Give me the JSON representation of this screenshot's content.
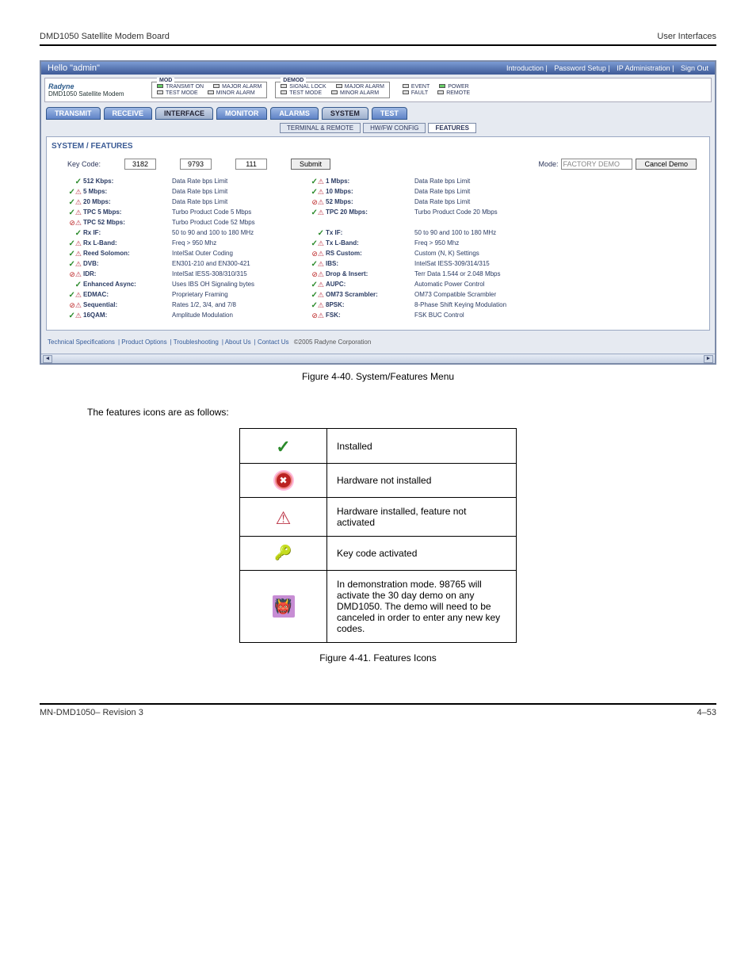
{
  "doc": {
    "header_left": "DMD1050 Satellite Modem Board",
    "header_right": "User Interfaces",
    "footer_left": "MN-DMD1050– Revision 3",
    "footer_right": "4–53"
  },
  "app": {
    "hello": "Hello \"admin\"",
    "nav_links": [
      "Introduction",
      "Password Setup",
      "IP Administration",
      "Sign Out"
    ],
    "logo_top": "Radyne",
    "logo_sub": "DMD1050 Satellite Modem",
    "status": {
      "mod": {
        "legend": "MOD",
        "rows": [
          [
            "TRANSMIT ON",
            "MAJOR ALARM"
          ],
          [
            "TEST MODE",
            "MINOR ALARM"
          ]
        ]
      },
      "demod": {
        "legend": "DEMOD",
        "rows": [
          [
            "SIGNAL LOCK",
            "MAJOR ALARM"
          ],
          [
            "TEST MODE",
            "MINOR ALARM"
          ]
        ]
      },
      "right": {
        "rows": [
          [
            "EVENT",
            "POWER"
          ],
          [
            "FAULT",
            "REMOTE"
          ]
        ]
      }
    },
    "tabs": [
      "TRANSMIT",
      "RECEIVE",
      "INTERFACE",
      "MONITOR",
      "ALARMS",
      "SYSTEM",
      "TEST"
    ],
    "subtabs": [
      "TERMINAL & REMOTE",
      "HW/FW CONFIG",
      "FEATURES"
    ],
    "section_title": "SYSTEM / FEATURES",
    "keycode": {
      "label": "Key Code:",
      "v1": "3182",
      "v2": "9793",
      "v3": "111",
      "submit": "Submit",
      "mode_label": "Mode:",
      "mode_value": "FACTORY DEMO",
      "cancel": "Cancel Demo"
    },
    "features_left": [
      {
        "i": "ck",
        "n": "512 Kbps:",
        "d": "Data Rate bps Limit"
      },
      {
        "i": "ck wn",
        "n": "5 Mbps:",
        "d": "Data Rate bps Limit"
      },
      {
        "i": "ck wn",
        "n": "20 Mbps:",
        "d": "Data Rate bps Limit"
      },
      {
        "i": "ck wn",
        "n": "TPC 5 Mbps:",
        "d": "Turbo Product Code 5 Mbps"
      },
      {
        "i": "cr wn",
        "n": "TPC 52 Mbps:",
        "d": "Turbo Product Code 52 Mbps"
      },
      {
        "i": "ck",
        "n": "Rx IF:",
        "d": "50 to 90 and 100 to 180 MHz"
      },
      {
        "i": "ck wn",
        "n": "Rx L-Band:",
        "d": "Freq > 950 Mhz"
      },
      {
        "i": "ck wn",
        "n": "Reed Solomon:",
        "d": "IntelSat Outer Coding"
      },
      {
        "i": "ck wn",
        "n": "DVB:",
        "d": "EN301-210 and EN300-421"
      },
      {
        "i": "cr wn",
        "n": "IDR:",
        "d": "IntelSat IESS-308/310/315"
      },
      {
        "i": "ck",
        "n": "Enhanced Async:",
        "d": "Uses IBS OH Signaling bytes"
      },
      {
        "i": "ck wn",
        "n": "EDMAC:",
        "d": "Proprietary Framing"
      },
      {
        "i": "cr wn",
        "n": "Sequential:",
        "d": "Rates 1/2, 3/4, and 7/8"
      },
      {
        "i": "ck wn",
        "n": "16QAM:",
        "d": "Amplitude Modulation"
      }
    ],
    "features_right": [
      {
        "i": "ck wn",
        "n": "1 Mbps:",
        "d": "Data Rate bps Limit"
      },
      {
        "i": "ck wn",
        "n": "10 Mbps:",
        "d": "Data Rate bps Limit"
      },
      {
        "i": "cr wn",
        "n": "52 Mbps:",
        "d": "Data Rate bps Limit"
      },
      {
        "i": "ck wn",
        "n": "TPC 20 Mbps:",
        "d": "Turbo Product Code 20 Mbps"
      },
      {
        "i": "",
        "n": "",
        "d": ""
      },
      {
        "i": "ck",
        "n": "Tx IF:",
        "d": "50 to 90 and 100 to 180 MHz"
      },
      {
        "i": "ck wn",
        "n": "Tx L-Band:",
        "d": "Freq > 950 Mhz"
      },
      {
        "i": "cr wn",
        "n": "RS Custom:",
        "d": "Custom (N, K) Settings"
      },
      {
        "i": "ck wn",
        "n": "IBS:",
        "d": "IntelSat IESS-309/314/315"
      },
      {
        "i": "cr wn",
        "n": "Drop & Insert:",
        "d": "Terr Data 1.544 or 2.048 Mbps"
      },
      {
        "i": "ck wn",
        "n": "AUPC:",
        "d": "Automatic Power Control"
      },
      {
        "i": "ck wn",
        "n": "OM73 Scrambler:",
        "d": "OM73 Compatible Scrambler"
      },
      {
        "i": "ck wn",
        "n": "8PSK:",
        "d": "8-Phase Shift Keying Modulation"
      },
      {
        "i": "cr wn",
        "n": "FSK:",
        "d": "FSK BUC Control"
      }
    ],
    "footer_links": [
      "Technical Specifications",
      "Product Options",
      "Troubleshooting",
      "About Us",
      "Contact Us",
      "©2005 Radyne Corporation"
    ]
  },
  "caption1": "Figure 4-40. System/Features Menu",
  "intro_text": "The features icons are as follows:",
  "legend": [
    {
      "cls": "li-check",
      "txt": "Installed"
    },
    {
      "cls": "li-no",
      "txt": "Hardware not installed"
    },
    {
      "cls": "li-warn",
      "txt": "Hardware installed, feature not activated"
    },
    {
      "cls": "li-key",
      "txt": "Key code activated"
    },
    {
      "cls": "li-demo",
      "txt": "In demonstration mode.  98765 will activate the 30 day demo on any DMD1050.  The demo will need to be canceled in order to enter any new key codes."
    }
  ],
  "caption2": "Figure 4-41. Features Icons"
}
